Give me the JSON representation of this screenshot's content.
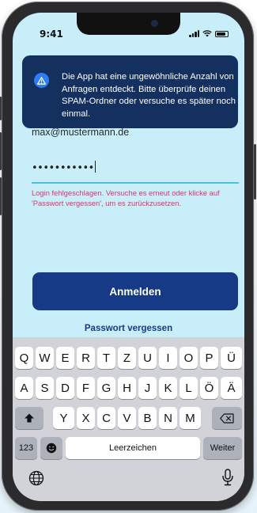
{
  "status_bar": {
    "time": "9:41"
  },
  "toast": {
    "message": "Die App hat eine ungewöhnliche Anzahl von Anfragen entdeckt. Bitte überprüfe deinen SPAM-Ordner oder versuche es später noch einmal.",
    "icon": "warning-icon"
  },
  "form": {
    "email_value": "max@mustermann.de",
    "password_value": "•••••••••••",
    "error_message": "Login fehlgeschlagen. Versuche es erneut oder klicke auf 'Passwort vergessen', um es zurückzusetzen.",
    "login_button": "Anmelden",
    "forgot_link": "Passwort vergessen"
  },
  "keyboard": {
    "row1": [
      "Q",
      "W",
      "E",
      "R",
      "T",
      "Z",
      "U",
      "I",
      "O",
      "P",
      "Ü"
    ],
    "row2": [
      "A",
      "S",
      "D",
      "F",
      "G",
      "H",
      "J",
      "K",
      "L",
      "Ö",
      "Ä"
    ],
    "row3": [
      "Y",
      "X",
      "C",
      "V",
      "B",
      "N",
      "M"
    ],
    "numbers_key": "123",
    "space_key": "Leerzeichen",
    "return_key": "Weiter",
    "icons": [
      "shift-icon",
      "backspace-icon",
      "emoji-icon",
      "globe-icon",
      "microphone-icon"
    ]
  },
  "colors": {
    "screen_bg": "#c8eefa",
    "toast_bg": "#13305f",
    "button_bg": "#173a86",
    "error": "#e0326e",
    "field_line": "#3fc6e6"
  }
}
